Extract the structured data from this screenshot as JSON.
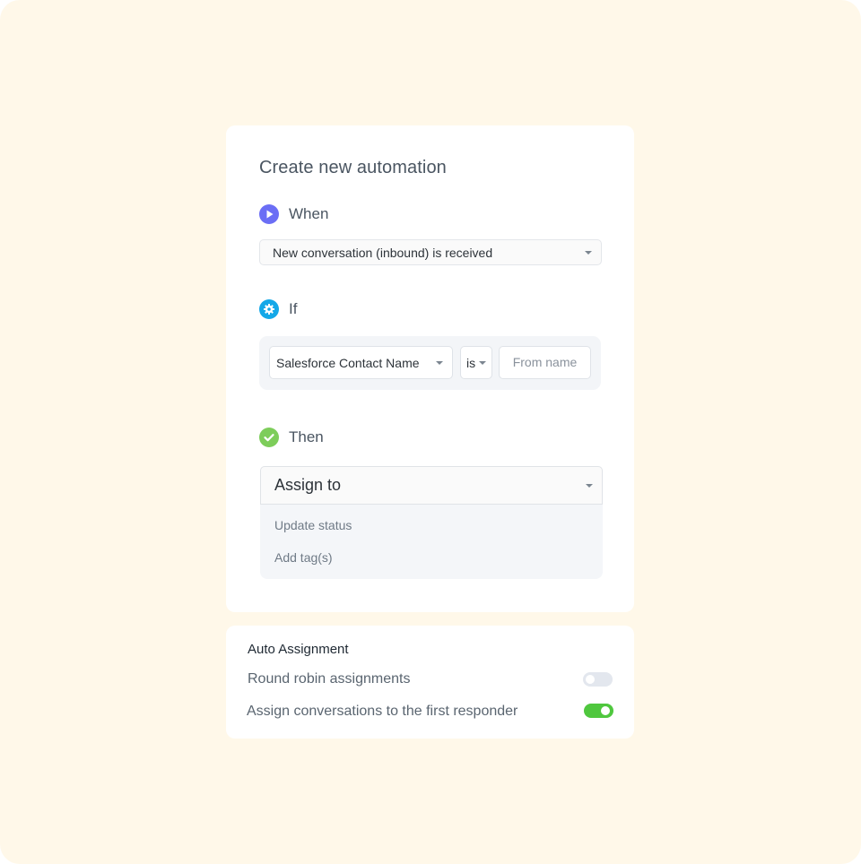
{
  "automation": {
    "title": "Create new automation",
    "when": {
      "label": "When",
      "trigger": "New conversation (inbound) is received"
    },
    "if": {
      "label": "If",
      "field": "Salesforce Contact Name",
      "operator": "is",
      "value_placeholder": "From name"
    },
    "then": {
      "label": "Then",
      "action": "Assign to",
      "options": [
        "Update status",
        "Add tag(s)"
      ]
    }
  },
  "auto_assignment": {
    "heading": "Auto Assignment",
    "round_robin": {
      "label": "Round robin assignments",
      "enabled": false
    },
    "first_responder": {
      "label": "Assign conversations to the first responder",
      "enabled": true
    }
  },
  "icons": {
    "when": "play-icon",
    "if": "gear-icon",
    "then": "check-icon"
  },
  "colors": {
    "background": "#fff8e9",
    "when_accent": "#6b6ef5",
    "if_accent": "#14a8e8",
    "then_accent": "#7dcd5a",
    "toggle_on": "#4fc73e",
    "toggle_off": "#e3e7ee"
  }
}
